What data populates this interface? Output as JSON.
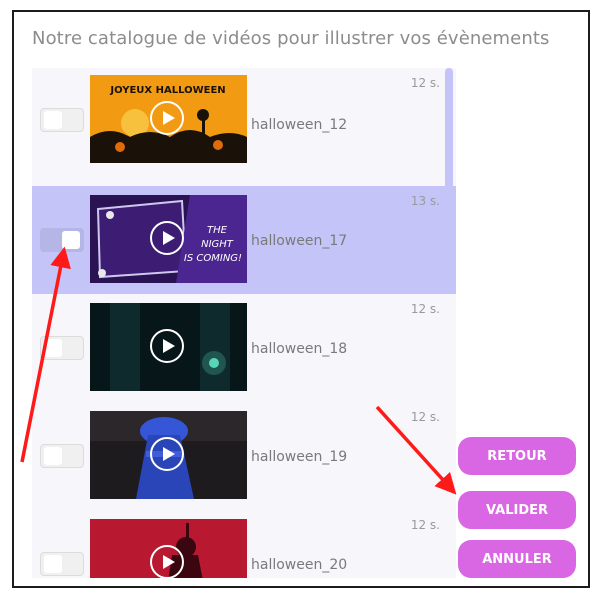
{
  "title": "Notre catalogue de vidéos pour illustrer vos évènements",
  "videos": [
    {
      "name": "halloween_12",
      "duration": "12 s.",
      "selected": false,
      "overlay": "JOYEUX HALLOWEEN"
    },
    {
      "name": "halloween_17",
      "duration": "13 s.",
      "selected": true,
      "overlay": "THE NIGHT IS COMING!"
    },
    {
      "name": "halloween_18",
      "duration": "12 s.",
      "selected": false,
      "overlay": ""
    },
    {
      "name": "halloween_19",
      "duration": "12 s.",
      "selected": false,
      "overlay": ""
    },
    {
      "name": "halloween_20",
      "duration": "12 s.",
      "selected": false,
      "overlay": ""
    }
  ],
  "buttons": {
    "retour": "RETOUR",
    "valider": "VALIDER",
    "annuler": "ANNULER"
  },
  "colors": {
    "accent": "#d967e3",
    "selected_row": "#c4c4f8",
    "annotation_arrow": "#ff1a1a"
  }
}
